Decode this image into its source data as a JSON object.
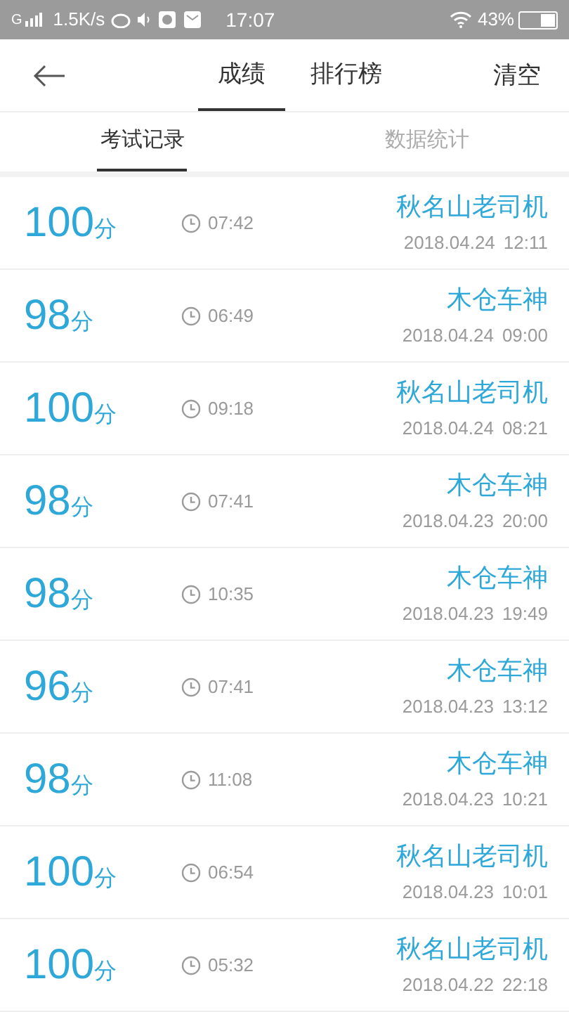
{
  "status_bar": {
    "carrier": "G",
    "speed": "1.5K/s",
    "time": "17:07",
    "battery": "43%"
  },
  "header": {
    "tabs": [
      {
        "label": "成绩",
        "selected": true
      },
      {
        "label": "排行榜",
        "selected": false
      }
    ],
    "action": "清空"
  },
  "sub_tabs": [
    {
      "label": "考试记录",
      "selected": true
    },
    {
      "label": "数据统计",
      "selected": false
    }
  ],
  "records": [
    {
      "score": "100",
      "unit": "分",
      "duration": "07:42",
      "name": "秋名山老司机",
      "date": "2018.04.24",
      "time": "12:11"
    },
    {
      "score": "98",
      "unit": "分",
      "duration": "06:49",
      "name": "木仓车神",
      "date": "2018.04.24",
      "time": "09:00"
    },
    {
      "score": "100",
      "unit": "分",
      "duration": "09:18",
      "name": "秋名山老司机",
      "date": "2018.04.24",
      "time": "08:21"
    },
    {
      "score": "98",
      "unit": "分",
      "duration": "07:41",
      "name": "木仓车神",
      "date": "2018.04.23",
      "time": "20:00"
    },
    {
      "score": "98",
      "unit": "分",
      "duration": "10:35",
      "name": "木仓车神",
      "date": "2018.04.23",
      "time": "19:49"
    },
    {
      "score": "96",
      "unit": "分",
      "duration": "07:41",
      "name": "木仓车神",
      "date": "2018.04.23",
      "time": "13:12"
    },
    {
      "score": "98",
      "unit": "分",
      "duration": "11:08",
      "name": "木仓车神",
      "date": "2018.04.23",
      "time": "10:21"
    },
    {
      "score": "100",
      "unit": "分",
      "duration": "06:54",
      "name": "秋名山老司机",
      "date": "2018.04.23",
      "time": "10:01"
    },
    {
      "score": "100",
      "unit": "分",
      "duration": "05:32",
      "name": "秋名山老司机",
      "date": "2018.04.22",
      "time": "22:18"
    }
  ]
}
